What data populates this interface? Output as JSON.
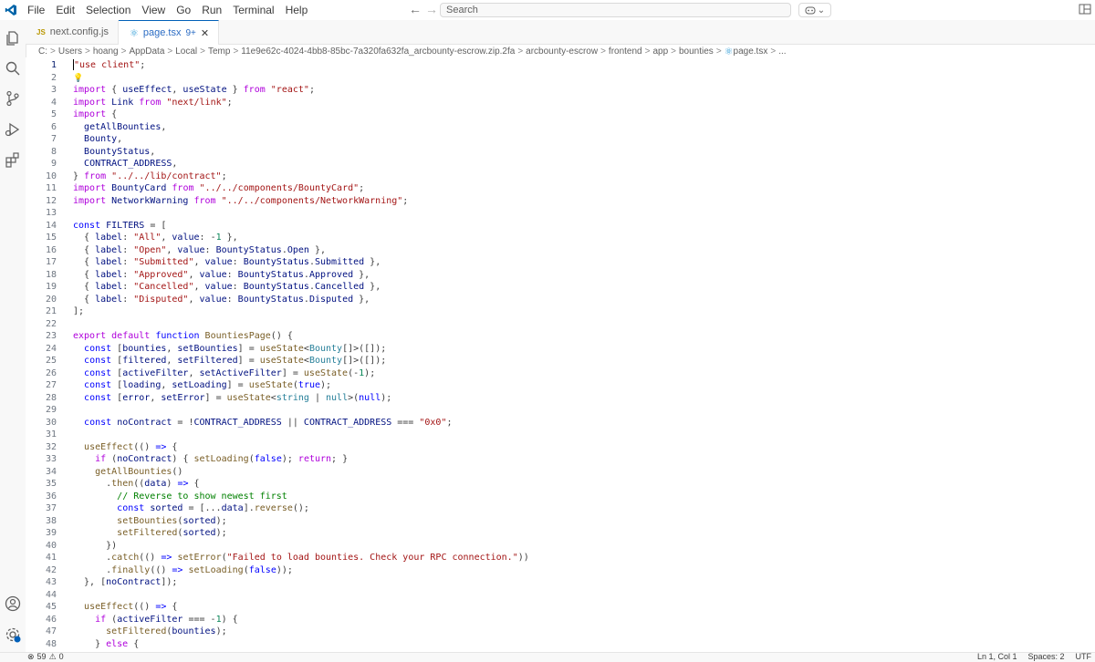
{
  "menu": [
    "File",
    "Edit",
    "Selection",
    "View",
    "Go",
    "Run",
    "Terminal",
    "Help"
  ],
  "search": {
    "placeholder": "Search"
  },
  "tabs": [
    {
      "label": "next.config.js",
      "badge": "JS",
      "active": false
    },
    {
      "label": "page.tsx",
      "suffix": "9+",
      "active": true
    }
  ],
  "breadcrumb": [
    "C:",
    "Users",
    "hoang",
    "AppData",
    "Local",
    "Temp",
    "11e9e62c-4024-4bb8-85bc-7a320fa632fa_arcbounty-escrow.zip.2fa",
    "arcbounty-escrow",
    "frontend",
    "app",
    "bounties",
    "page.tsx",
    "..."
  ],
  "status": {
    "errors": "59",
    "warnings": "0",
    "position": "Ln 1, Col 1",
    "spaces": "Spaces: 2",
    "encoding": "UTF"
  },
  "lines": [
    [
      [
        "str",
        "\"use client\""
      ],
      [
        "op",
        ";"
      ]
    ],
    [],
    [
      [
        "kw",
        "import"
      ],
      [
        "op",
        " { "
      ],
      [
        "vr",
        "useEffect"
      ],
      [
        "op",
        ", "
      ],
      [
        "vr",
        "useState"
      ],
      [
        "op",
        " } "
      ],
      [
        "kw",
        "from"
      ],
      [
        "op",
        " "
      ],
      [
        "str",
        "\"react\""
      ],
      [
        "op",
        ";"
      ]
    ],
    [
      [
        "kw",
        "import"
      ],
      [
        "op",
        " "
      ],
      [
        "vr",
        "Link"
      ],
      [
        "op",
        " "
      ],
      [
        "kw",
        "from"
      ],
      [
        "op",
        " "
      ],
      [
        "str",
        "\"next/link\""
      ],
      [
        "op",
        ";"
      ]
    ],
    [
      [
        "kw",
        "import"
      ],
      [
        "op",
        " {"
      ]
    ],
    [
      [
        "op",
        "  "
      ],
      [
        "vr",
        "getAllBounties"
      ],
      [
        "op",
        ","
      ]
    ],
    [
      [
        "op",
        "  "
      ],
      [
        "vr",
        "Bounty"
      ],
      [
        "op",
        ","
      ]
    ],
    [
      [
        "op",
        "  "
      ],
      [
        "vr",
        "BountyStatus"
      ],
      [
        "op",
        ","
      ]
    ],
    [
      [
        "op",
        "  "
      ],
      [
        "vr",
        "CONTRACT_ADDRESS"
      ],
      [
        "op",
        ","
      ]
    ],
    [
      [
        "op",
        "} "
      ],
      [
        "kw",
        "from"
      ],
      [
        "op",
        " "
      ],
      [
        "str",
        "\"../../lib/contract\""
      ],
      [
        "op",
        ";"
      ]
    ],
    [
      [
        "kw",
        "import"
      ],
      [
        "op",
        " "
      ],
      [
        "vr",
        "BountyCard"
      ],
      [
        "op",
        " "
      ],
      [
        "kw",
        "from"
      ],
      [
        "op",
        " "
      ],
      [
        "str",
        "\"../../components/BountyCard\""
      ],
      [
        "op",
        ";"
      ]
    ],
    [
      [
        "kw",
        "import"
      ],
      [
        "op",
        " "
      ],
      [
        "vr",
        "NetworkWarning"
      ],
      [
        "op",
        " "
      ],
      [
        "kw",
        "from"
      ],
      [
        "op",
        " "
      ],
      [
        "str",
        "\"../../components/NetworkWarning\""
      ],
      [
        "op",
        ";"
      ]
    ],
    [],
    [
      [
        "tk",
        "const"
      ],
      [
        "op",
        " "
      ],
      [
        "vr",
        "FILTERS"
      ],
      [
        "op",
        " = ["
      ]
    ],
    [
      [
        "op",
        "  { "
      ],
      [
        "vr",
        "label"
      ],
      [
        "op",
        ": "
      ],
      [
        "str",
        "\"All\""
      ],
      [
        "op",
        ", "
      ],
      [
        "vr",
        "value"
      ],
      [
        "op",
        ": "
      ],
      [
        "op",
        "-"
      ],
      [
        "num",
        "1"
      ],
      [
        "op",
        " },"
      ]
    ],
    [
      [
        "op",
        "  { "
      ],
      [
        "vr",
        "label"
      ],
      [
        "op",
        ": "
      ],
      [
        "str",
        "\"Open\""
      ],
      [
        "op",
        ", "
      ],
      [
        "vr",
        "value"
      ],
      [
        "op",
        ": "
      ],
      [
        "vr",
        "BountyStatus"
      ],
      [
        "op",
        "."
      ],
      [
        "vr",
        "Open"
      ],
      [
        "op",
        " },"
      ]
    ],
    [
      [
        "op",
        "  { "
      ],
      [
        "vr",
        "label"
      ],
      [
        "op",
        ": "
      ],
      [
        "str",
        "\"Submitted\""
      ],
      [
        "op",
        ", "
      ],
      [
        "vr",
        "value"
      ],
      [
        "op",
        ": "
      ],
      [
        "vr",
        "BountyStatus"
      ],
      [
        "op",
        "."
      ],
      [
        "vr",
        "Submitted"
      ],
      [
        "op",
        " },"
      ]
    ],
    [
      [
        "op",
        "  { "
      ],
      [
        "vr",
        "label"
      ],
      [
        "op",
        ": "
      ],
      [
        "str",
        "\"Approved\""
      ],
      [
        "op",
        ", "
      ],
      [
        "vr",
        "value"
      ],
      [
        "op",
        ": "
      ],
      [
        "vr",
        "BountyStatus"
      ],
      [
        "op",
        "."
      ],
      [
        "vr",
        "Approved"
      ],
      [
        "op",
        " },"
      ]
    ],
    [
      [
        "op",
        "  { "
      ],
      [
        "vr",
        "label"
      ],
      [
        "op",
        ": "
      ],
      [
        "str",
        "\"Cancelled\""
      ],
      [
        "op",
        ", "
      ],
      [
        "vr",
        "value"
      ],
      [
        "op",
        ": "
      ],
      [
        "vr",
        "BountyStatus"
      ],
      [
        "op",
        "."
      ],
      [
        "vr",
        "Cancelled"
      ],
      [
        "op",
        " },"
      ]
    ],
    [
      [
        "op",
        "  { "
      ],
      [
        "vr",
        "label"
      ],
      [
        "op",
        ": "
      ],
      [
        "str",
        "\"Disputed\""
      ],
      [
        "op",
        ", "
      ],
      [
        "vr",
        "value"
      ],
      [
        "op",
        ": "
      ],
      [
        "vr",
        "BountyStatus"
      ],
      [
        "op",
        "."
      ],
      [
        "vr",
        "Disputed"
      ],
      [
        "op",
        " },"
      ]
    ],
    [
      [
        "op",
        "];"
      ]
    ],
    [],
    [
      [
        "kw",
        "export"
      ],
      [
        "op",
        " "
      ],
      [
        "kw",
        "default"
      ],
      [
        "op",
        " "
      ],
      [
        "tk",
        "function"
      ],
      [
        "op",
        " "
      ],
      [
        "fn",
        "BountiesPage"
      ],
      [
        "op",
        "() {"
      ]
    ],
    [
      [
        "op",
        "  "
      ],
      [
        "tk",
        "const"
      ],
      [
        "op",
        " ["
      ],
      [
        "vr",
        "bounties"
      ],
      [
        "op",
        ", "
      ],
      [
        "vr",
        "setBounties"
      ],
      [
        "op",
        "] = "
      ],
      [
        "fn",
        "useState"
      ],
      [
        "op",
        "<"
      ],
      [
        "ty",
        "Bounty"
      ],
      [
        "op",
        "[]>([]);"
      ]
    ],
    [
      [
        "op",
        "  "
      ],
      [
        "tk",
        "const"
      ],
      [
        "op",
        " ["
      ],
      [
        "vr",
        "filtered"
      ],
      [
        "op",
        ", "
      ],
      [
        "vr",
        "setFiltered"
      ],
      [
        "op",
        "] = "
      ],
      [
        "fn",
        "useState"
      ],
      [
        "op",
        "<"
      ],
      [
        "ty",
        "Bounty"
      ],
      [
        "op",
        "[]>([]);"
      ]
    ],
    [
      [
        "op",
        "  "
      ],
      [
        "tk",
        "const"
      ],
      [
        "op",
        " ["
      ],
      [
        "vr",
        "activeFilter"
      ],
      [
        "op",
        ", "
      ],
      [
        "vr",
        "setActiveFilter"
      ],
      [
        "op",
        "] = "
      ],
      [
        "fn",
        "useState"
      ],
      [
        "op",
        "("
      ],
      [
        "op",
        "-"
      ],
      [
        "num",
        "1"
      ],
      [
        "op",
        ");"
      ]
    ],
    [
      [
        "op",
        "  "
      ],
      [
        "tk",
        "const"
      ],
      [
        "op",
        " ["
      ],
      [
        "vr",
        "loading"
      ],
      [
        "op",
        ", "
      ],
      [
        "vr",
        "setLoading"
      ],
      [
        "op",
        "] = "
      ],
      [
        "fn",
        "useState"
      ],
      [
        "op",
        "("
      ],
      [
        "tk",
        "true"
      ],
      [
        "op",
        ");"
      ]
    ],
    [
      [
        "op",
        "  "
      ],
      [
        "tk",
        "const"
      ],
      [
        "op",
        " ["
      ],
      [
        "vr",
        "error"
      ],
      [
        "op",
        ", "
      ],
      [
        "vr",
        "setError"
      ],
      [
        "op",
        "] = "
      ],
      [
        "fn",
        "useState"
      ],
      [
        "op",
        "<"
      ],
      [
        "ty",
        "string"
      ],
      [
        "op",
        " | "
      ],
      [
        "ty",
        "null"
      ],
      [
        "op",
        ">("
      ],
      [
        "tk",
        "null"
      ],
      [
        "op",
        ");"
      ]
    ],
    [],
    [
      [
        "op",
        "  "
      ],
      [
        "tk",
        "const"
      ],
      [
        "op",
        " "
      ],
      [
        "vr",
        "noContract"
      ],
      [
        "op",
        " = !"
      ],
      [
        "vr",
        "CONTRACT_ADDRESS"
      ],
      [
        "op",
        " || "
      ],
      [
        "vr",
        "CONTRACT_ADDRESS"
      ],
      [
        "op",
        " === "
      ],
      [
        "str",
        "\"0x0\""
      ],
      [
        "op",
        ";"
      ]
    ],
    [],
    [
      [
        "op",
        "  "
      ],
      [
        "fn",
        "useEffect"
      ],
      [
        "op",
        "(() "
      ],
      [
        "tk",
        "=>"
      ],
      [
        "op",
        " {"
      ]
    ],
    [
      [
        "op",
        "    "
      ],
      [
        "kw",
        "if"
      ],
      [
        "op",
        " ("
      ],
      [
        "vr",
        "noContract"
      ],
      [
        "op",
        ") { "
      ],
      [
        "fn",
        "setLoading"
      ],
      [
        "op",
        "("
      ],
      [
        "tk",
        "false"
      ],
      [
        "op",
        "); "
      ],
      [
        "kw",
        "return"
      ],
      [
        "op",
        "; }"
      ]
    ],
    [
      [
        "op",
        "    "
      ],
      [
        "fn",
        "getAllBounties"
      ],
      [
        "op",
        "()"
      ]
    ],
    [
      [
        "op",
        "      ."
      ],
      [
        "fn",
        "then"
      ],
      [
        "op",
        "(("
      ],
      [
        "vr",
        "data"
      ],
      [
        "op",
        ") "
      ],
      [
        "tk",
        "=>"
      ],
      [
        "op",
        " {"
      ]
    ],
    [
      [
        "op",
        "        "
      ],
      [
        "cm",
        "// Reverse to show newest first"
      ]
    ],
    [
      [
        "op",
        "        "
      ],
      [
        "tk",
        "const"
      ],
      [
        "op",
        " "
      ],
      [
        "vr",
        "sorted"
      ],
      [
        "op",
        " = [..."
      ],
      [
        "vr",
        "data"
      ],
      [
        "op",
        "]."
      ],
      [
        "fn",
        "reverse"
      ],
      [
        "op",
        "();"
      ]
    ],
    [
      [
        "op",
        "        "
      ],
      [
        "fn",
        "setBounties"
      ],
      [
        "op",
        "("
      ],
      [
        "vr",
        "sorted"
      ],
      [
        "op",
        ");"
      ]
    ],
    [
      [
        "op",
        "        "
      ],
      [
        "fn",
        "setFiltered"
      ],
      [
        "op",
        "("
      ],
      [
        "vr",
        "sorted"
      ],
      [
        "op",
        ");"
      ]
    ],
    [
      [
        "op",
        "      })"
      ]
    ],
    [
      [
        "op",
        "      ."
      ],
      [
        "fn",
        "catch"
      ],
      [
        "op",
        "(() "
      ],
      [
        "tk",
        "=>"
      ],
      [
        "op",
        " "
      ],
      [
        "fn",
        "setError"
      ],
      [
        "op",
        "("
      ],
      [
        "str",
        "\"Failed to load bounties. Check your RPC connection.\""
      ],
      [
        "op",
        "))"
      ]
    ],
    [
      [
        "op",
        "      ."
      ],
      [
        "fn",
        "finally"
      ],
      [
        "op",
        "(() "
      ],
      [
        "tk",
        "=>"
      ],
      [
        "op",
        " "
      ],
      [
        "fn",
        "setLoading"
      ],
      [
        "op",
        "("
      ],
      [
        "tk",
        "false"
      ],
      [
        "op",
        "));"
      ]
    ],
    [
      [
        "op",
        "  }, ["
      ],
      [
        "vr",
        "noContract"
      ],
      [
        "op",
        "]);"
      ]
    ],
    [],
    [
      [
        "op",
        "  "
      ],
      [
        "fn",
        "useEffect"
      ],
      [
        "op",
        "(() "
      ],
      [
        "tk",
        "=>"
      ],
      [
        "op",
        " {"
      ]
    ],
    [
      [
        "op",
        "    "
      ],
      [
        "kw",
        "if"
      ],
      [
        "op",
        " ("
      ],
      [
        "vr",
        "activeFilter"
      ],
      [
        "op",
        " === "
      ],
      [
        "op",
        "-"
      ],
      [
        "num",
        "1"
      ],
      [
        "op",
        ") {"
      ]
    ],
    [
      [
        "op",
        "      "
      ],
      [
        "fn",
        "setFiltered"
      ],
      [
        "op",
        "("
      ],
      [
        "vr",
        "bounties"
      ],
      [
        "op",
        ");"
      ]
    ],
    [
      [
        "op",
        "    } "
      ],
      [
        "kw",
        "else"
      ],
      [
        "op",
        " {"
      ]
    ]
  ]
}
